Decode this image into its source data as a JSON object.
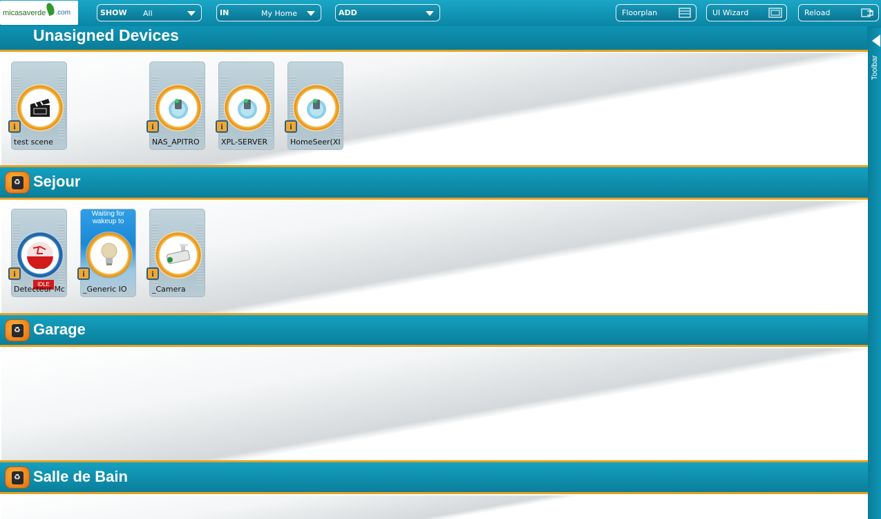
{
  "logo": {
    "text": "micasaverde",
    "suffix": ".com"
  },
  "filters": {
    "show": {
      "label": "SHOW",
      "value": "All"
    },
    "in": {
      "label": "IN",
      "value": "My Home"
    },
    "add": {
      "label": "ADD",
      "value": ""
    }
  },
  "buttons": {
    "floorplan": "Floorplan",
    "ui_wizard": "UI Wizard",
    "reload": "Reload"
  },
  "page_title": "Unasigned Devices",
  "toolbar_label": "Toolbar",
  "rooms": [
    {
      "name": "Sejour"
    },
    {
      "name": "Garage"
    },
    {
      "name": "Salle de Bain"
    }
  ],
  "unassigned_devices": [
    {
      "name": "test scene",
      "icon": "clapperboard-icon"
    },
    {
      "name": "NAS_APITRO",
      "icon": "plugin-globe-icon"
    },
    {
      "name": "XPL-SERVER",
      "icon": "plugin-globe-icon"
    },
    {
      "name": "HomeSeer(XI",
      "icon": "plugin-globe-icon"
    }
  ],
  "sejour_devices": [
    {
      "name": "Detecteur Mc",
      "icon": "motion-sensor-icon",
      "status": "IDLE"
    },
    {
      "name": "_Generic IO",
      "icon": "light-bulb-icon",
      "status": "Waiting for wakeup to"
    },
    {
      "name": "_Camera",
      "icon": "camera-icon"
    }
  ],
  "info_glyph": "i",
  "colors": {
    "background": "#0a7f9c",
    "accent_orange": "#e9a11f",
    "waiting_blue": "#2f9fe6"
  }
}
